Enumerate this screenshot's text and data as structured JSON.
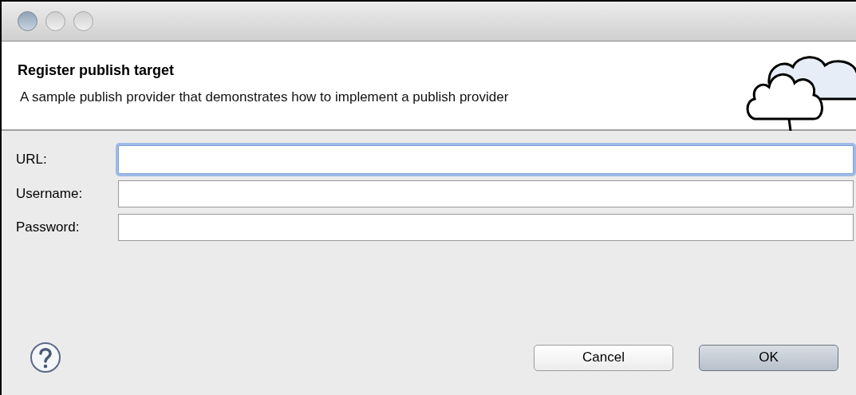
{
  "header": {
    "title": "Register publish target",
    "description": "A sample publish provider that demonstrates how to implement a publish provider"
  },
  "fields": [
    {
      "label": "URL:",
      "focused": true
    },
    {
      "label": "Username:",
      "focused": false
    },
    {
      "label": "Password:",
      "focused": false
    }
  ],
  "buttons": [
    {
      "label": "Cancel",
      "kind": "secondary"
    },
    {
      "label": "OK",
      "kind": "default"
    }
  ]
}
